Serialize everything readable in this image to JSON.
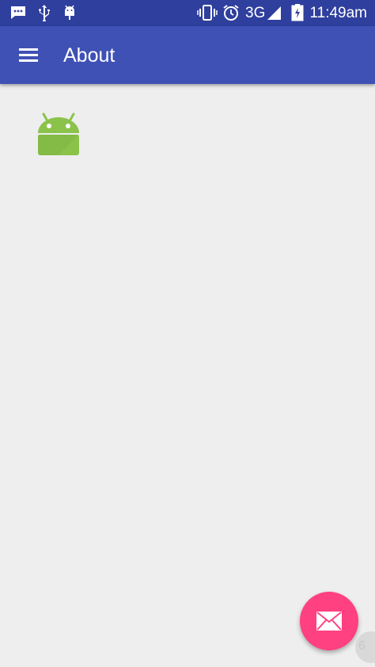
{
  "status_bar": {
    "time": "11:49am",
    "network": "3G",
    "icons": [
      "message-icon",
      "usb-icon",
      "android-debug-icon",
      "vibrate-icon",
      "alarm-icon",
      "signal-icon",
      "battery-charging-icon"
    ]
  },
  "app_bar": {
    "title": "About",
    "menu_icon": "hamburger-menu-icon",
    "color": "#3f51b5"
  },
  "content": {
    "logo_icon": "android-robot-icon"
  },
  "fab": {
    "icon": "email-icon",
    "color": "#ff4081"
  },
  "corner_badge": {
    "text": "6"
  },
  "colors": {
    "status_bar": "#2f3f9e",
    "background": "#eeeeee",
    "android_green": "#8bc34a"
  }
}
